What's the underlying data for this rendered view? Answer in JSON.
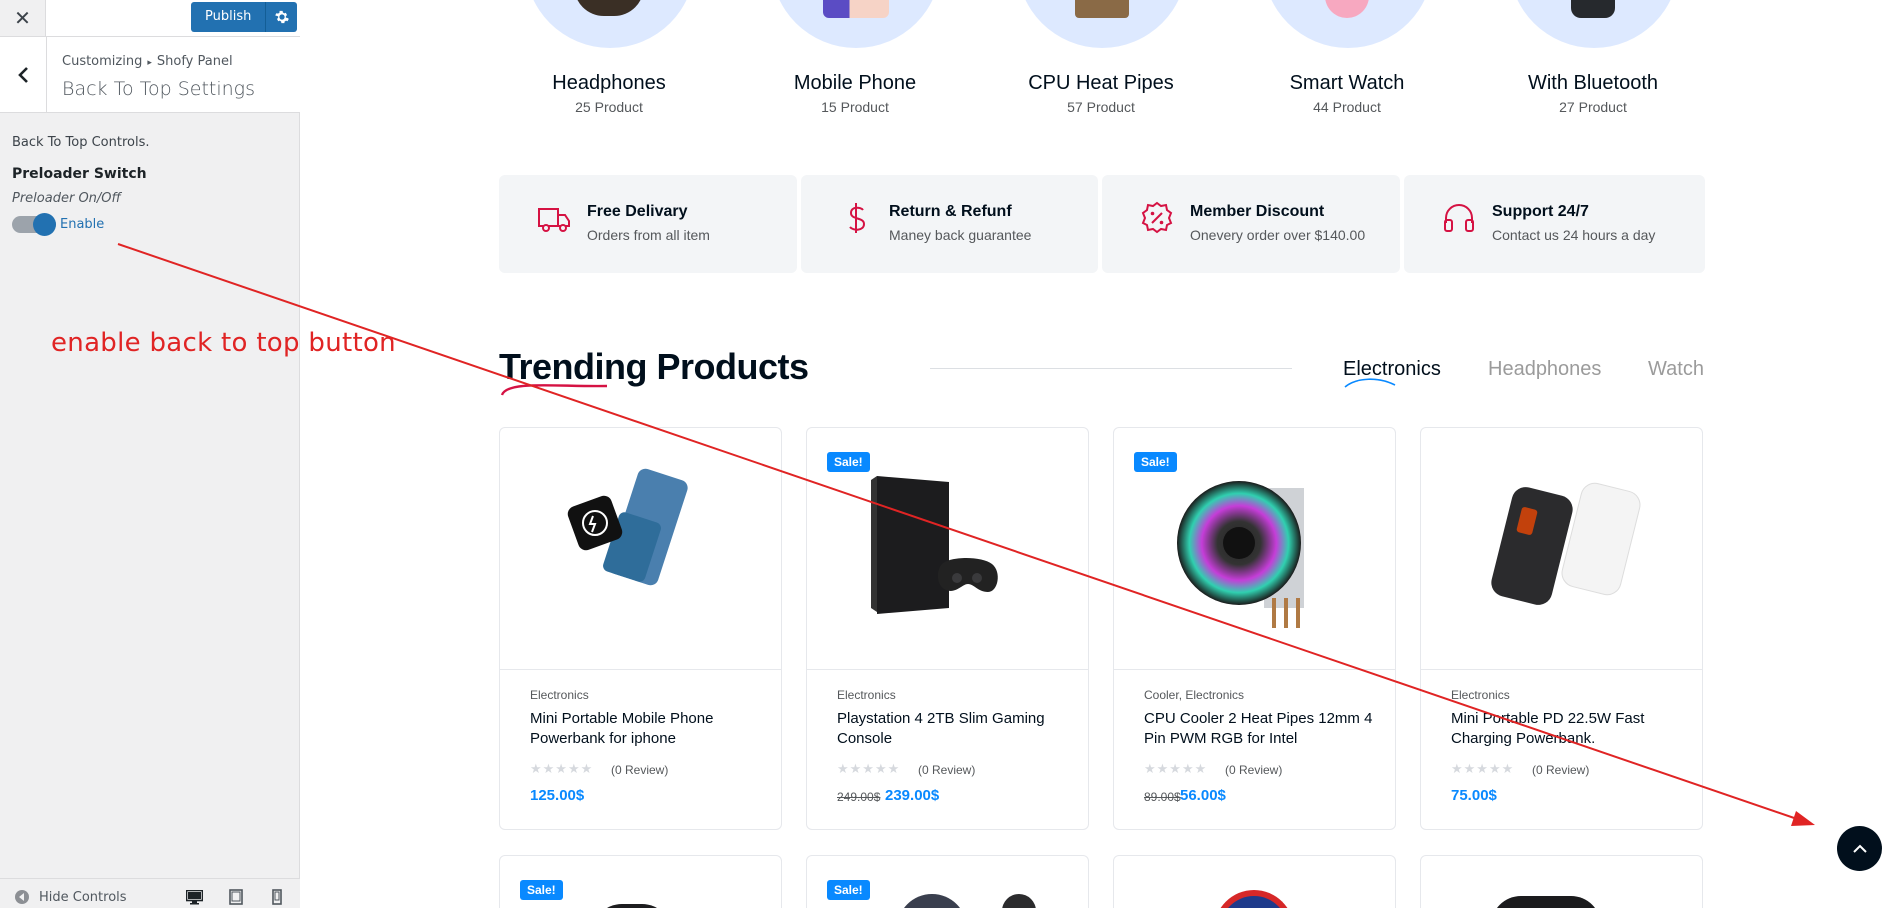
{
  "sidebar": {
    "close_icon": "close-icon",
    "publish_label": "Publish",
    "crumb_root": "Customizing",
    "crumb_child": "Shofy Panel",
    "panel_title": "Back To Top Settings",
    "controls_desc": "Back To Top Controls.",
    "switch_title": "Preloader Switch",
    "switch_sub": "Preloader On/Off",
    "toggle_state": "on",
    "toggle_label": "Enable",
    "hide_controls_label": "Hide Controls"
  },
  "annotation": {
    "text": "enable back to top button",
    "color": "#e02424"
  },
  "categories": [
    {
      "name": "Headphones",
      "count": "25 Product"
    },
    {
      "name": "Mobile Phone",
      "count": "15 Product"
    },
    {
      "name": "CPU Heat Pipes",
      "count": "57 Product"
    },
    {
      "name": "Smart Watch",
      "count": "44 Product"
    },
    {
      "name": "With Bluetooth",
      "count": "27 Product"
    }
  ],
  "features": [
    {
      "title": "Free Delivary",
      "sub": "Orders from all item",
      "icon": "truck-icon"
    },
    {
      "title": "Return & Refunf",
      "sub": "Maney back guarantee",
      "icon": "dollar-icon"
    },
    {
      "title": "Member Discount",
      "sub": "Onevery order over $140.00",
      "icon": "discount-badge-icon"
    },
    {
      "title": "Support 24/7",
      "sub": "Contact us 24 hours a day",
      "icon": "headset-icon"
    }
  ],
  "trending": {
    "title": "Trending Products",
    "tabs": [
      "Electronics",
      "Headphones",
      "Watch"
    ],
    "active_tab": "Electronics"
  },
  "products": [
    {
      "category": "Electronics",
      "title": "Mini Portable Mobile Phone Powerbank for iphone",
      "review": "(0 Review)",
      "old_price": "",
      "price": "125.00$",
      "sale": false
    },
    {
      "category": "Electronics",
      "title": "Playstation 4 2TB Slim Gaming Console",
      "review": "(0 Review)",
      "old_price": "249.00$",
      "price": "239.00$",
      "sale": true,
      "sale_label": "Sale!"
    },
    {
      "category": "Cooler, Electronics",
      "title": "CPU Cooler 2 Heat Pipes 12mm 4 Pin PWM RGB for Intel",
      "review": "(0 Review)",
      "old_price": "89.00$",
      "price": "56.00$",
      "sale": true,
      "sale_label": "Sale!"
    },
    {
      "category": "Electronics",
      "title": "Mini Portable PD 22.5W Fast Charging Powerbank.",
      "review": "(0 Review)",
      "old_price": "",
      "price": "75.00$",
      "sale": false
    }
  ],
  "second_row_sale_labels": [
    "Sale!",
    "Sale!"
  ],
  "colors": {
    "accent_blue": "#0989ff",
    "wp_blue": "#2271b1",
    "feature_icon_red": "#d51243"
  }
}
